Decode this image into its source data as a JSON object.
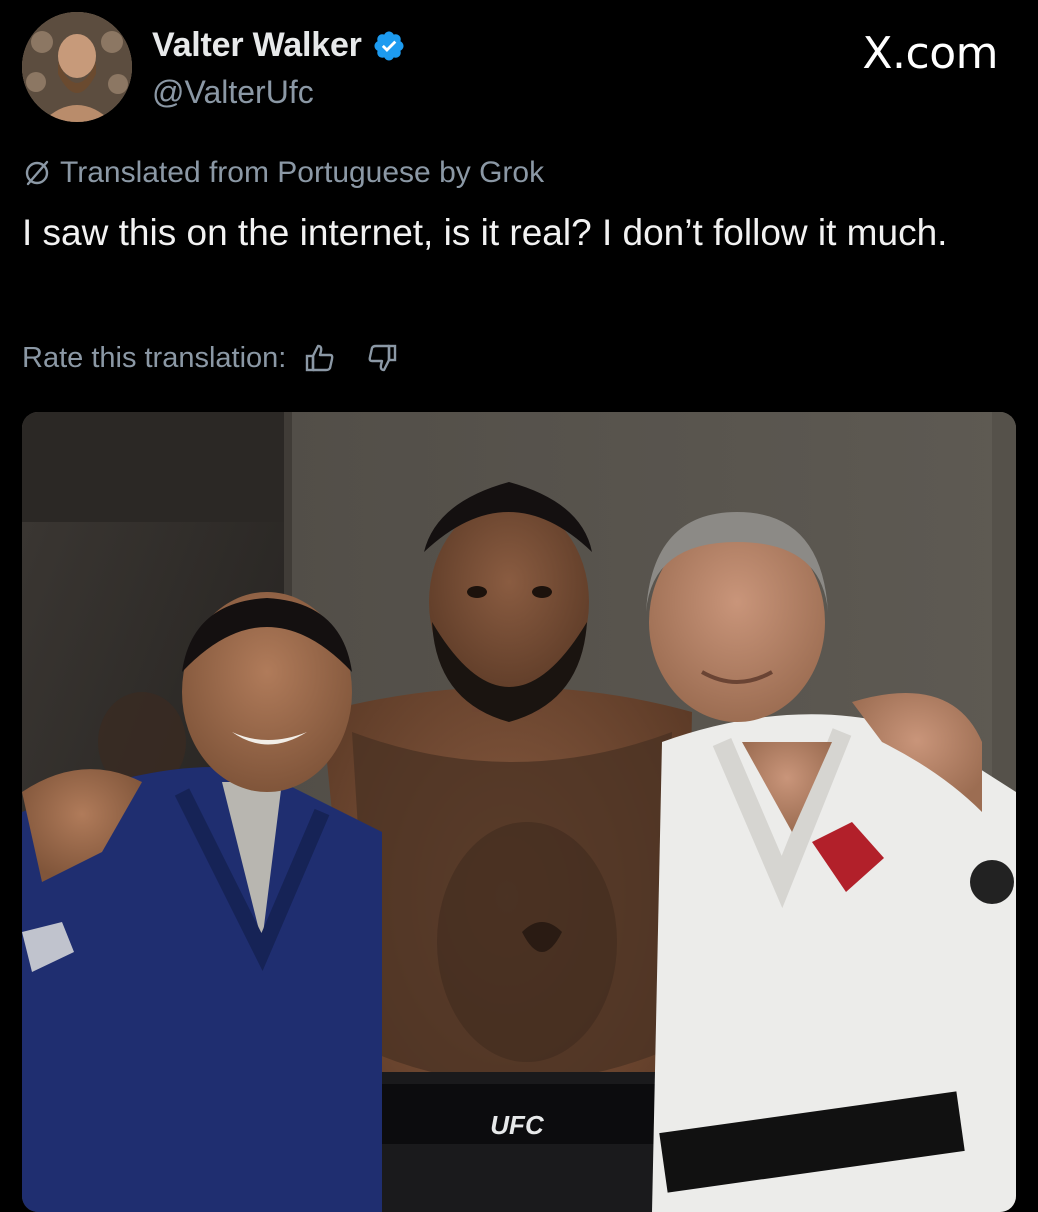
{
  "post": {
    "author": {
      "name": "Valter Walker",
      "handle": "@ValterUfc",
      "verified": true,
      "avatar_icon": "profile-photo",
      "verified_icon": "verified-badge-icon",
      "verified_color": "#1d9bf0"
    },
    "brand": "X.com",
    "translation_notice": "Translated from Portuguese by Grok",
    "translation_icon": "translate-slash-icon",
    "text": "I saw this on the internet, is it real? I don’t follow it much.",
    "rate": {
      "label": "Rate this translation:",
      "thumbs_up_icon": "thumbs-up-icon",
      "thumbs_down_icon": "thumbs-down-icon"
    },
    "media": {
      "kind": "photo",
      "shorts_text": "UFC"
    }
  },
  "colors": {
    "background": "#000000",
    "primary_text": "#e7e9ea",
    "secondary_text": "#8b98a5",
    "accent": "#1d9bf0"
  }
}
